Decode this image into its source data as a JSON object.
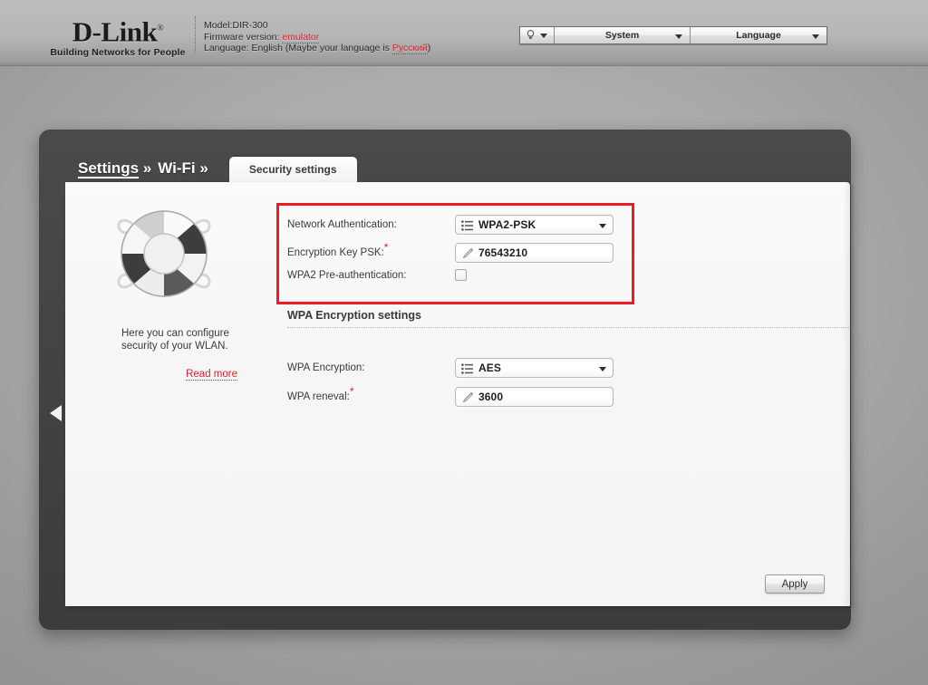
{
  "header": {
    "logo_main": "D-Link",
    "logo_reg": "®",
    "logo_sub": "Building Networks for People",
    "model_label": "Model:",
    "model_value": "DIR-300",
    "firmware_label": "Firmware version:",
    "firmware_value": "emulator",
    "language_prefix": "Language: English (Maybe your language is",
    "language_link": "Русский",
    "language_suffix": ")",
    "controls": {
      "bulb_icon": "lightbulb-icon",
      "system_label": "System",
      "language_label": "Language"
    }
  },
  "tabs": {
    "breadcrumb_settings": "Settings",
    "breadcrumb_sep": "»",
    "breadcrumb_wifi": "Wi-Fi",
    "active_tab": "Security settings"
  },
  "sidebar": {
    "icon": "lifebuoy-icon",
    "description": "Here you can configure security of your WLAN.",
    "read_more": "Read more"
  },
  "form": {
    "network_auth_label": "Network Authentication:",
    "network_auth_value": "WPA2-PSK",
    "encryption_key_label": "Encryption Key PSK:",
    "encryption_key_value": "76543210",
    "preauth_label": "WPA2 Pre-authentication:",
    "preauth_checked": false,
    "section_title": "WPA Encryption settings",
    "wpa_encryption_label": "WPA Encryption:",
    "wpa_encryption_value": "AES",
    "wpa_renewal_label": "WPA reneval:",
    "wpa_renewal_value": "3600",
    "required_marker": "*"
  },
  "footer": {
    "apply_label": "Apply"
  },
  "colors": {
    "accent_red": "#d5232f",
    "highlight_border": "#ec1c24",
    "frame_dark": "#444444"
  }
}
